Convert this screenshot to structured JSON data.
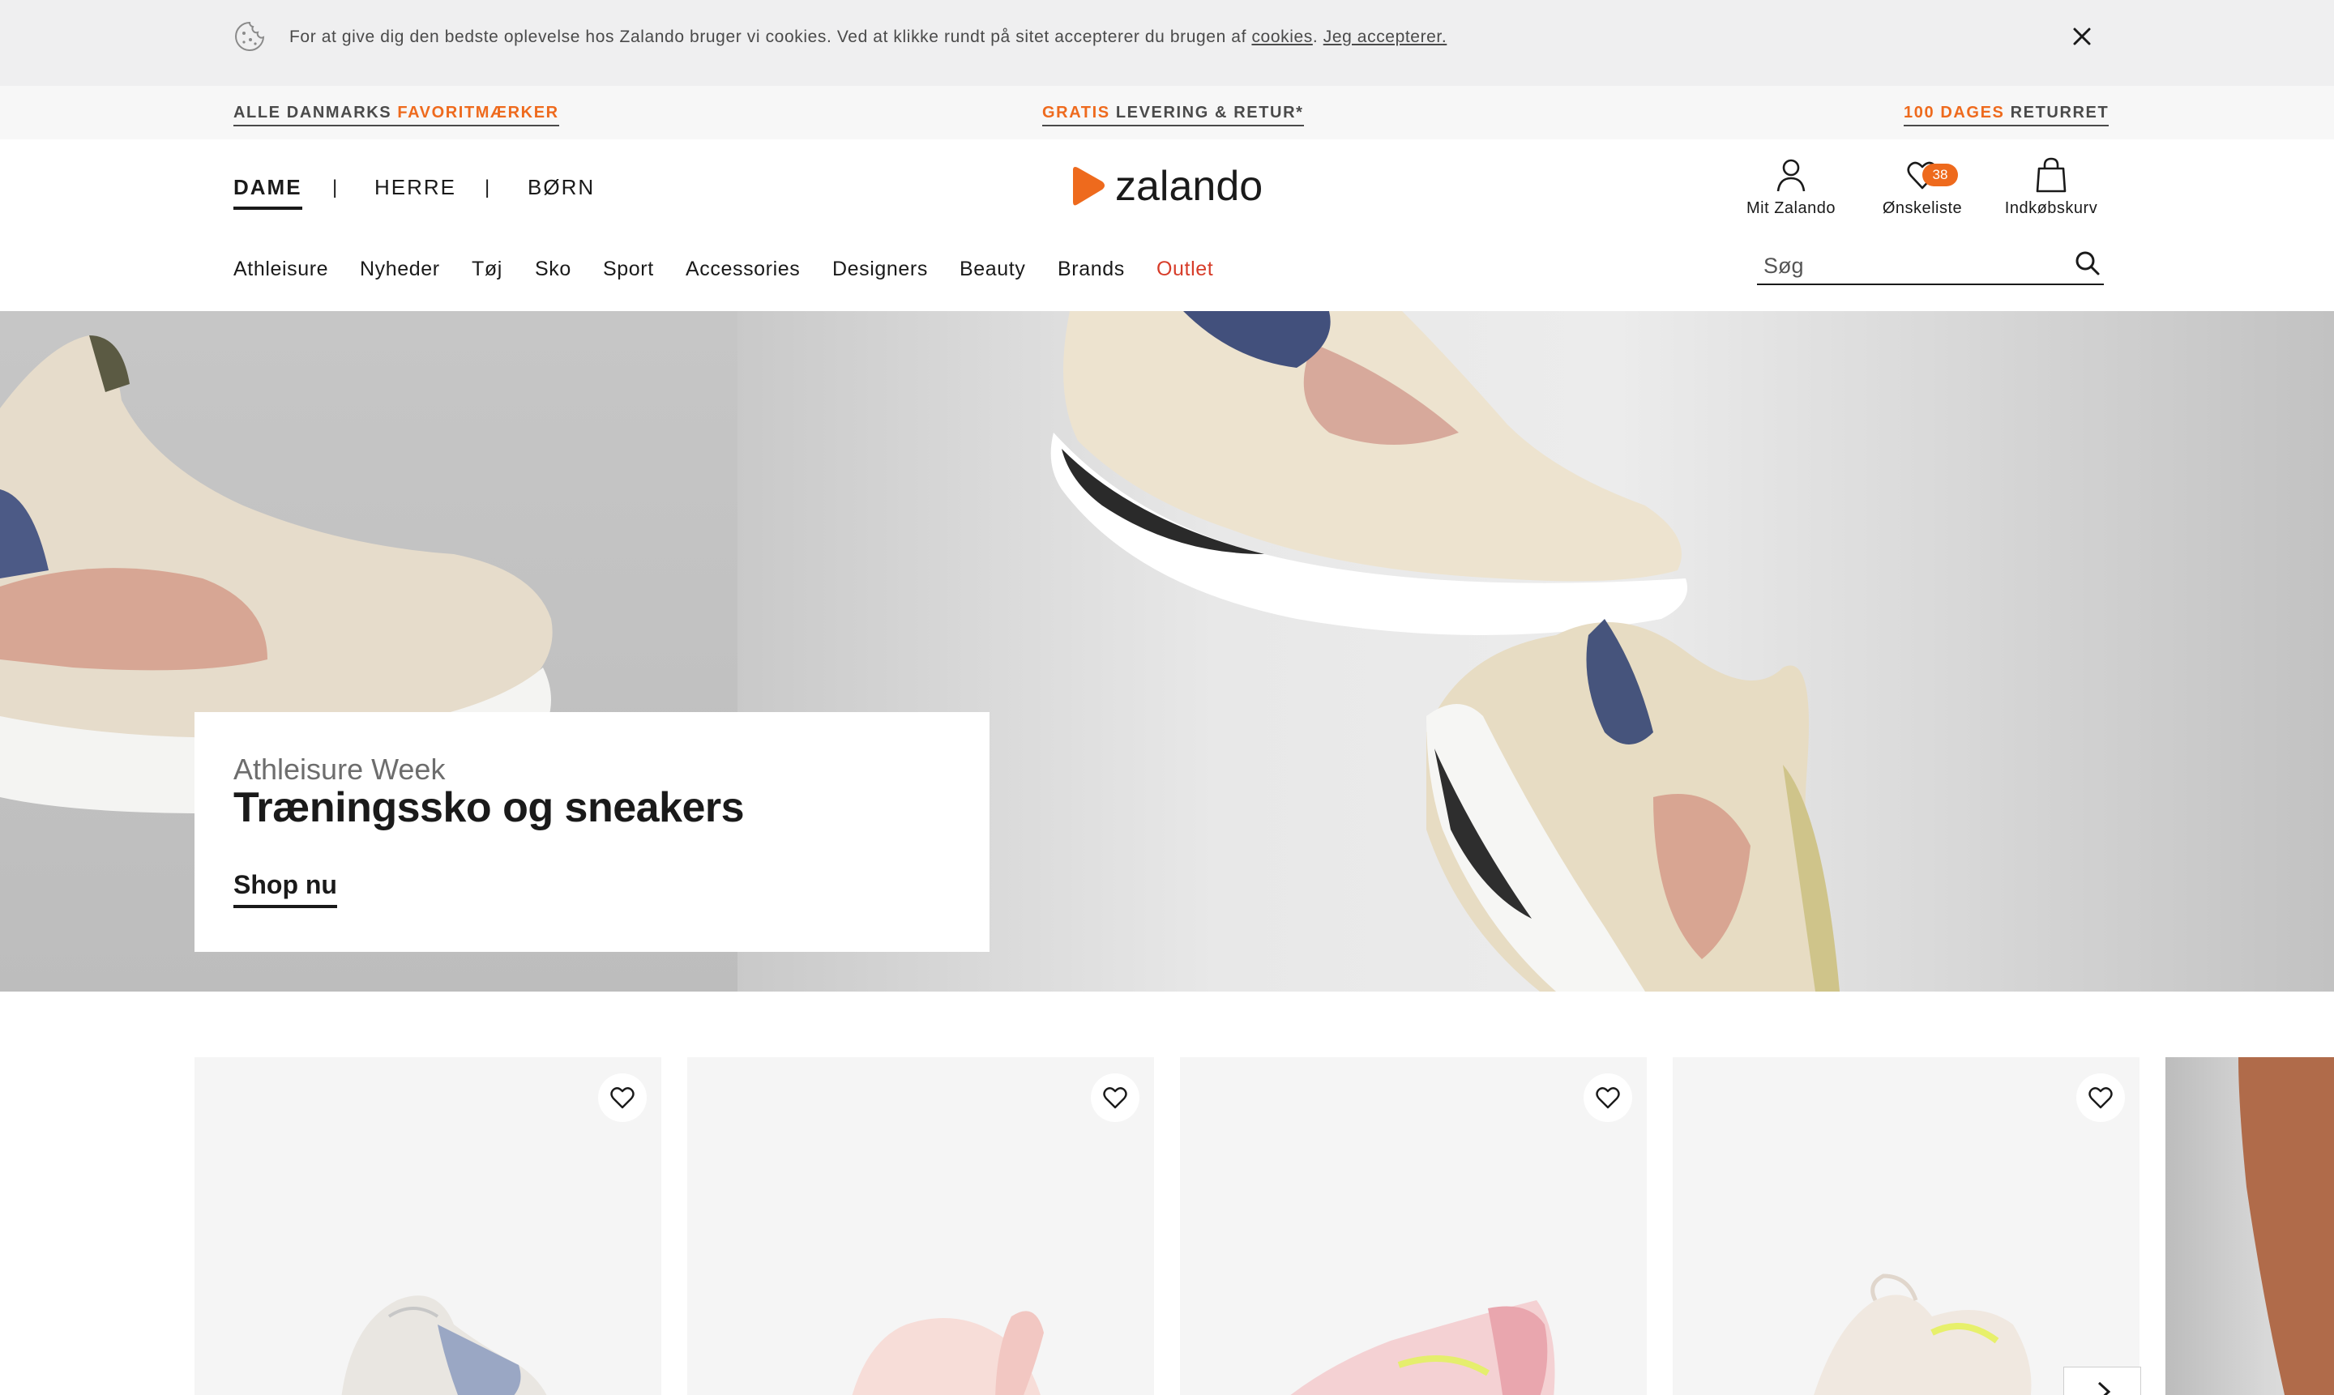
{
  "cookie_bar": {
    "text": "For at give dig den bedste oplevelse hos Zalando bruger vi cookies. Ved at klikke rundt på sitet accepterer du brugen af ",
    "cookies_link": "cookies",
    "accept_link": "Jeg accepterer.",
    "icons": {
      "cookie": "cookie-icon",
      "close": "close-icon"
    }
  },
  "promo": [
    {
      "plain": "ALLE DANMARKS ",
      "accent": "FAVORITMÆRKER",
      "order": "plain-first"
    },
    {
      "accent": "GRATIS",
      "plain": " LEVERING & RETUR*",
      "order": "accent-first"
    },
    {
      "accent": "100 DAGES",
      "plain": " RETURRET",
      "order": "accent-first"
    }
  ],
  "header": {
    "genders": [
      "DAME",
      "HERRE",
      "BØRN"
    ],
    "gender_separator": "|",
    "logo_text": "zalando",
    "account_label": "Mit Zalando",
    "wishlist_label": "Ønskeliste",
    "wishlist_count": "38",
    "cart_label": "Indkøbskurv",
    "categories": [
      "Athleisure",
      "Nyheder",
      "Tøj",
      "Sko",
      "Sport",
      "Accessories",
      "Designers",
      "Beauty",
      "Brands",
      "Outlet"
    ],
    "search_placeholder": "Søg"
  },
  "hero": {
    "subtitle": "Athleisure Week",
    "title": "Træningssko og sneakers",
    "cta": "Shop nu"
  },
  "products": {
    "cards": [
      {
        "id": 1,
        "colors": [
          "#9aa7c4",
          "#e9e6e1"
        ]
      },
      {
        "id": 2,
        "colors": [
          "#f2c7c2",
          "#f7ddd8"
        ]
      },
      {
        "id": 3,
        "colors": [
          "#e9a6ae",
          "#f4d1d3"
        ]
      },
      {
        "id": 4,
        "colors": [
          "#f0e8e0",
          "#e7f06b"
        ]
      }
    ],
    "icons": {
      "wishlist": "heart-icon",
      "next": "chevron-right-icon"
    }
  },
  "colors": {
    "accent": "#ee6a1d",
    "outlet": "#d73c29",
    "text": "#1a1a1a"
  }
}
